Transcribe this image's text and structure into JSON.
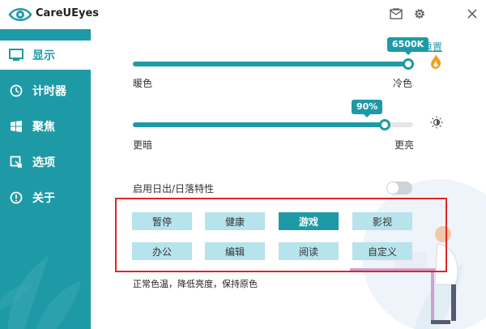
{
  "app": {
    "title": "CareUEyes"
  },
  "titlebar": {
    "icons": [
      "mail-icon",
      "gear-icon",
      "close-icon"
    ]
  },
  "sidebar": {
    "items": [
      {
        "label": "显示",
        "icon": "monitor-icon",
        "active": true
      },
      {
        "label": "计时器",
        "icon": "clock-icon",
        "active": false
      },
      {
        "label": "聚焦",
        "icon": "windows-icon",
        "active": false
      },
      {
        "label": "选项",
        "icon": "option-icon",
        "active": false
      },
      {
        "label": "关于",
        "icon": "info-icon",
        "active": false
      }
    ]
  },
  "temperature": {
    "value_label": "6500K",
    "reset_label": "重置",
    "low_label": "暖色",
    "high_label": "冷色",
    "level": 1.0
  },
  "brightness": {
    "value_label": "90%",
    "low_label": "更暗",
    "high_label": "更亮",
    "level": 0.9
  },
  "sunrise_sunset": {
    "label": "启用日出/日落特性",
    "enabled": false
  },
  "modes": {
    "row1": [
      "暂停",
      "健康",
      "游戏",
      "影视"
    ],
    "row2": [
      "办公",
      "编辑",
      "阅读",
      "自定义"
    ],
    "active": "游戏"
  },
  "description": "正常色温，降低亮度，保持原色",
  "colors": {
    "accent": "#1e9aa6",
    "mode_button": "#b6e3ec",
    "highlight": "#e0252c"
  }
}
